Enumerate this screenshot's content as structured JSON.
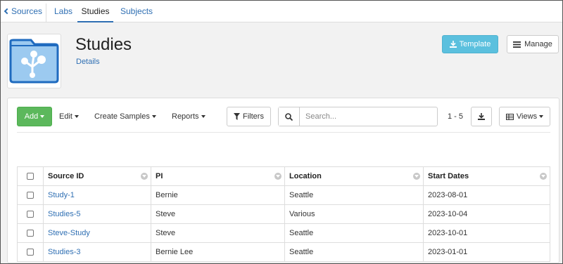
{
  "nav": {
    "sources": "Sources",
    "labs": "Labs",
    "studies": "Studies",
    "subjects": "Subjects"
  },
  "header": {
    "title": "Studies",
    "details_link": "Details",
    "template_label": "Template",
    "manage_label": "Manage"
  },
  "toolbar": {
    "add_label": "Add",
    "edit_label": "Edit",
    "create_samples_label": "Create Samples",
    "reports_label": "Reports",
    "filters_label": "Filters",
    "search_placeholder": "Search...",
    "pager_text": "1 - 5",
    "views_label": "Views"
  },
  "table": {
    "columns": [
      "Source ID",
      "PI",
      "Location",
      "Start Dates"
    ],
    "rows": [
      {
        "source_id": "Study-1",
        "pi": "Bernie",
        "location": "Seattle",
        "start_date": "2023-08-01"
      },
      {
        "source_id": "Studies-5",
        "pi": "Steve",
        "location": "Various",
        "start_date": "2023-10-04"
      },
      {
        "source_id": "Steve-Study",
        "pi": "Steve",
        "location": "Seattle",
        "start_date": "2023-10-01"
      },
      {
        "source_id": "Studies-3",
        "pi": "Bernie Lee",
        "location": "Seattle",
        "start_date": "2023-01-01"
      }
    ]
  },
  "colors": {
    "link": "#2f6fb3",
    "add_button": "#5cb85c",
    "template_button": "#5bc0de",
    "folder_fill": "#9ccaf0",
    "folder_stroke": "#1f6bbf"
  }
}
